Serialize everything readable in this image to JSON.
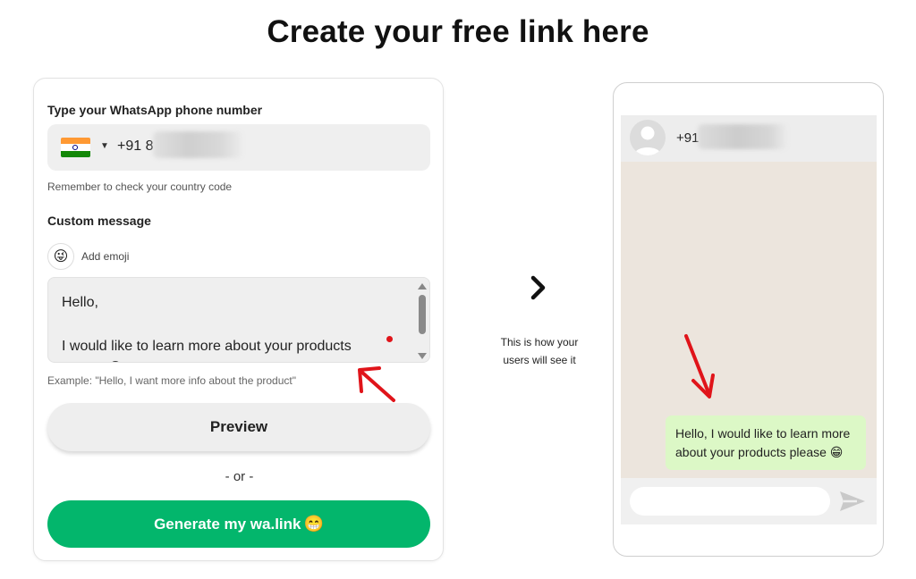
{
  "page": {
    "title": "Create your free link here"
  },
  "form": {
    "phone_label": "Type your WhatsApp phone number",
    "country_flag": "india-flag",
    "phone_value": "+91 8",
    "phone_hint": "Remember to check your country code",
    "message_label": "Custom message",
    "emoji_icon": "😜",
    "add_emoji_label": "Add emoji",
    "message_value": "Hello,\n\nI would like to learn more about your products\nplease 😁",
    "message_example": "Example: \"Hello, I want more info about the product\"",
    "preview_label": "Preview",
    "or_label": "- or -",
    "generate_label": "Generate my wa.link",
    "generate_emoji": "😁"
  },
  "preview": {
    "caption_line1": "This is how your",
    "caption_line2": "users will see it",
    "chat_phone": "+91",
    "bubble_text": "Hello, I would like to learn more about your products please 😁"
  },
  "colors": {
    "generate_button": "#03b66c",
    "chat_background": "#ece5dd",
    "bubble": "#dcf8c6",
    "annotation_arrow": "#e0141a"
  }
}
